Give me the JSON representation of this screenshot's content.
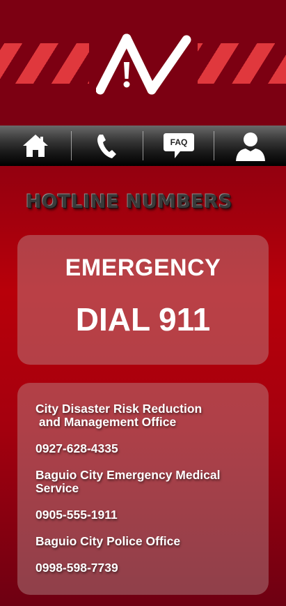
{
  "app": {
    "logo_letters": "AV"
  },
  "nav": {
    "items": [
      {
        "name": "home",
        "icon": "home-icon"
      },
      {
        "name": "call",
        "icon": "phone-icon"
      },
      {
        "name": "faq",
        "icon": "faq-icon",
        "label": "FAQ"
      },
      {
        "name": "profile",
        "icon": "user-icon"
      }
    ]
  },
  "page": {
    "title": "HOTLINE NUMBERS"
  },
  "emergency": {
    "label": "EMERGENCY",
    "dial": "DIAL 911"
  },
  "hotlines": [
    {
      "name": "City Disaster Risk Reduction\n and Management Office",
      "number": "0927-628-4335"
    },
    {
      "name": "Baguio City Emergency Medical\nService",
      "number": "0905-555-1911"
    },
    {
      "name": "Baguio City Police Office",
      "number": "0998-598-7739"
    }
  ],
  "colors": {
    "stripe": "#e53b3f",
    "header": "#7c0012",
    "accent": "#b8000a"
  }
}
